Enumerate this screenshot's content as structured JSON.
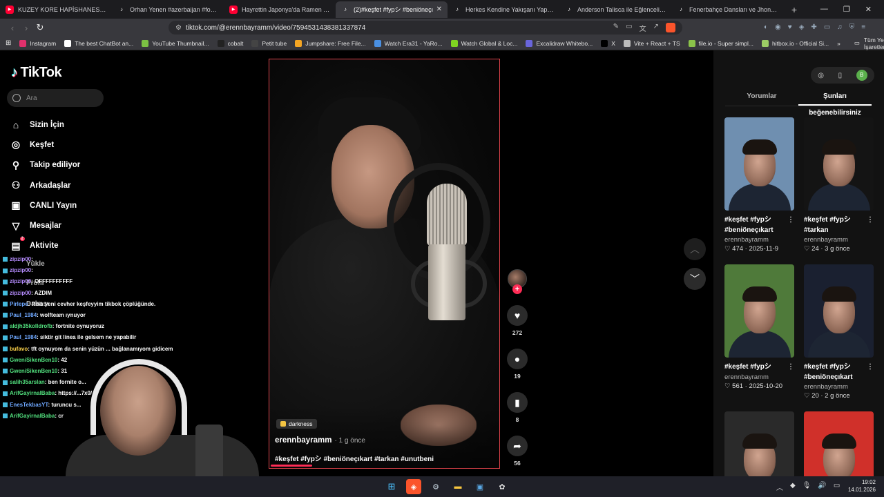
{
  "browser": {
    "tabs": [
      {
        "icon": "youtube",
        "label": "KUZEY KORE HAPİSHANESİNDEN KA",
        "active": false
      },
      {
        "icon": "tiktok",
        "label": "Orhan Yenen #azerbaijan #foryou #t",
        "active": false
      },
      {
        "icon": "youtube",
        "label": "Hayrettin Japonya'da Ramen Yeme D",
        "active": false
      },
      {
        "icon": "tiktok",
        "label": "(2)#keşfet #fypシ #beniöneçı",
        "active": true
      },
      {
        "icon": "tiktok",
        "label": "Herkes Kendine Yakışanı Yapıyor: Tal",
        "active": false
      },
      {
        "icon": "tiktok",
        "label": "Anderson Talisca ile Eğlenceli Bir Edi",
        "active": false
      },
      {
        "icon": "tiktok",
        "label": "Fenerbahçe Dansları ve Jhon Duran",
        "active": false
      }
    ],
    "new_tab": "+",
    "url": "tiktok.com/@erennbayramm/video/7594531438381337874",
    "bookmarks": [
      {
        "label": "Instagram",
        "color": "#e1306c"
      },
      {
        "label": "The best ChatBot an...",
        "color": "#ffffff"
      },
      {
        "label": "YouTube Thumbnail...",
        "color": "#7bc043"
      },
      {
        "label": "cobalt",
        "color": "#222222"
      },
      {
        "label": "Petit tube",
        "color": "#444444"
      },
      {
        "label": "Jumpshare: Free File...",
        "color": "#f5a623"
      },
      {
        "label": "Watch Era31 - YaRo...",
        "color": "#4a90e2"
      },
      {
        "label": "Watch Global & Loc...",
        "color": "#7ed321"
      },
      {
        "label": "Excalidraw Whitebo...",
        "color": "#6965db"
      },
      {
        "label": "X",
        "color": "#000000"
      },
      {
        "label": "Vite + React + TS",
        "color": "#bbbbbb"
      },
      {
        "label": "file.io - Super simpl...",
        "color": "#8bc34a"
      },
      {
        "label": "hitbox.io - Official Si...",
        "color": "#9ccc65"
      }
    ],
    "bookmarks_more": "»",
    "all_bookmarks": "Tüm Yer İşaretleri"
  },
  "tiktok": {
    "logo": "TikTok",
    "search_placeholder": "Ara",
    "nav": [
      {
        "label": "Sizin İçin",
        "icon": "home-icon",
        "glyph": "⌂"
      },
      {
        "label": "Keşfet",
        "icon": "compass-icon",
        "glyph": "◎"
      },
      {
        "label": "Takip ediliyor",
        "icon": "following-icon",
        "glyph": "⚲"
      },
      {
        "label": "Arkadaşlar",
        "icon": "friends-icon",
        "glyph": "⚇"
      },
      {
        "label": "CANLI Yayın",
        "icon": "live-icon",
        "glyph": "▣"
      },
      {
        "label": "Mesajlar",
        "icon": "messages-icon",
        "glyph": "▽"
      },
      {
        "label": "Aktivite",
        "icon": "activity-icon",
        "glyph": "▤",
        "badge": "2"
      }
    ],
    "nav_hidden": {
      "upload": "Yükle",
      "profile": "Profil",
      "more": "Dahası"
    },
    "video": {
      "sound": "darkness",
      "author": "erennbayramm",
      "time": "· 1 g önce",
      "caption": "#keşfet #fypシ #beniöneçıkart #tarkan #unutbeni"
    },
    "actions": {
      "likes": "272",
      "comments": "19",
      "saves": "8",
      "shares": "56"
    },
    "panel": {
      "tabs": [
        "Yorumlar",
        "Şunları beğenebilirsiniz"
      ],
      "avatar_letter": "B",
      "cards": [
        {
          "title": "#keşfet #fypシ #beniöneçıkart",
          "author": "erennbayramm",
          "meta": "♡ 474 · 2025-11-9",
          "bg": "#6f8fb0"
        },
        {
          "title": "#keşfet #fypシ #tarkan",
          "author": "erennbayramm",
          "meta": "♡ 24 · 3 g önce",
          "bg": "#141414"
        },
        {
          "title": "#keşfet #fypシ",
          "author": "erennbayramm",
          "meta": "♡ 561 · 2025-10-20",
          "bg": "#4f7a3a"
        },
        {
          "title": "#keşfet #fypシ #beniöneçıkart",
          "author": "erennbayramm",
          "meta": "♡ 20 · 2 g önce",
          "bg": "#1a2030"
        },
        {
          "title": "",
          "author": "",
          "meta": "",
          "bg": "#2a2a2a"
        },
        {
          "title": "",
          "author": "",
          "meta": "",
          "bg": "#d0302a"
        }
      ]
    }
  },
  "chat": [
    {
      "user": "zipzip00",
      "msg": ": ",
      "cls": "p"
    },
    {
      "user": "zipzip00",
      "msg": ": ",
      "cls": "p"
    },
    {
      "user": "zipzip00",
      "msg": ": OFFFFFFFFFF",
      "cls": "p"
    },
    {
      "user": "zipzip00",
      "msg": ": AZDIM",
      "cls": "p"
    },
    {
      "user": "Pirlepe",
      "msg": ": Reis yeni cevher keşfeyyim tikbok çöplüğünde.",
      "cls": ""
    },
    {
      "user": "Paul_1984",
      "msg": ": wolfteam ıynuyor",
      "cls": ""
    },
    {
      "user": "aldjh35kolldrofb",
      "msg": ": fortnite oynuyoruz",
      "cls": "g"
    },
    {
      "user": "Paul_1984",
      "msg": ": siktir git linea ile gelsem ne yapabilir",
      "cls": ""
    },
    {
      "user": "bufavo",
      "msg": ": tft oynuyom da senin yüzün ... bağlanamıyom gidicem",
      "cls": "y"
    },
    {
      "user": "GweniSikenBen10",
      "msg": ": 42",
      "cls": "g"
    },
    {
      "user": "GweniSikenBen10",
      "msg": ": 31",
      "cls": "g"
    },
    {
      "user": "salih35arslan",
      "msg": ": ben fornite o...",
      "cls": "g"
    },
    {
      "user": "ArifGayirnalBaba",
      "msg": ": https://...7x0/",
      "cls": "g"
    },
    {
      "user": "EnesTekbasYT",
      "msg": ": turuncu s...",
      "cls": ""
    },
    {
      "user": "ArifGayirnalBaba",
      "msg": ": cr",
      "cls": "g"
    }
  ],
  "taskbar": {
    "time": "19:02",
    "date": "14.01.2026"
  }
}
